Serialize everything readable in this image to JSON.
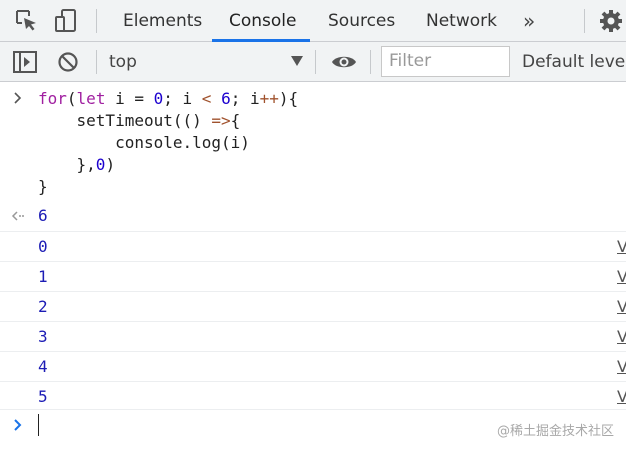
{
  "tabs": {
    "elements": "Elements",
    "console": "Console",
    "sources": "Sources",
    "network": "Network",
    "more": "»"
  },
  "toolbar": {
    "context": "top",
    "filter_placeholder": "Filter",
    "levels": "Default levels"
  },
  "code": {
    "line1": {
      "kw1": "for",
      "p1": "(",
      "kw2": "let",
      "p2": " i = ",
      "n1": "0",
      "p3": "; i ",
      "op1": "<",
      "p4": " ",
      "n2": "6",
      "p5": "; i",
      "op2": "++",
      "p6": "){"
    },
    "line2": {
      "p1": "    setTimeout(() ",
      "op1": "=>",
      "p2": "{"
    },
    "line3": "        console.log(i)",
    "line4": {
      "p1": "    },",
      "n1": "0",
      "p2": ")"
    },
    "line5": "}"
  },
  "result_value": "6",
  "logs": [
    {
      "value": "0",
      "source": "V"
    },
    {
      "value": "1",
      "source": "V"
    },
    {
      "value": "2",
      "source": "V"
    },
    {
      "value": "3",
      "source": "V"
    },
    {
      "value": "4",
      "source": "V"
    },
    {
      "value": "5",
      "source": "V"
    }
  ],
  "watermark": "@稀土掘金技术社区",
  "colors": {
    "keyword": "#a01fa0",
    "number": "#1c00cf",
    "accent": "#1a73e8"
  },
  "icons": [
    "inspect-icon",
    "device-toolbar-icon",
    "settings-gear-icon",
    "sidebar-toggle-icon",
    "clear-console-icon",
    "eye-icon",
    "prompt-chevron-icon",
    "result-arrow-icon"
  ]
}
